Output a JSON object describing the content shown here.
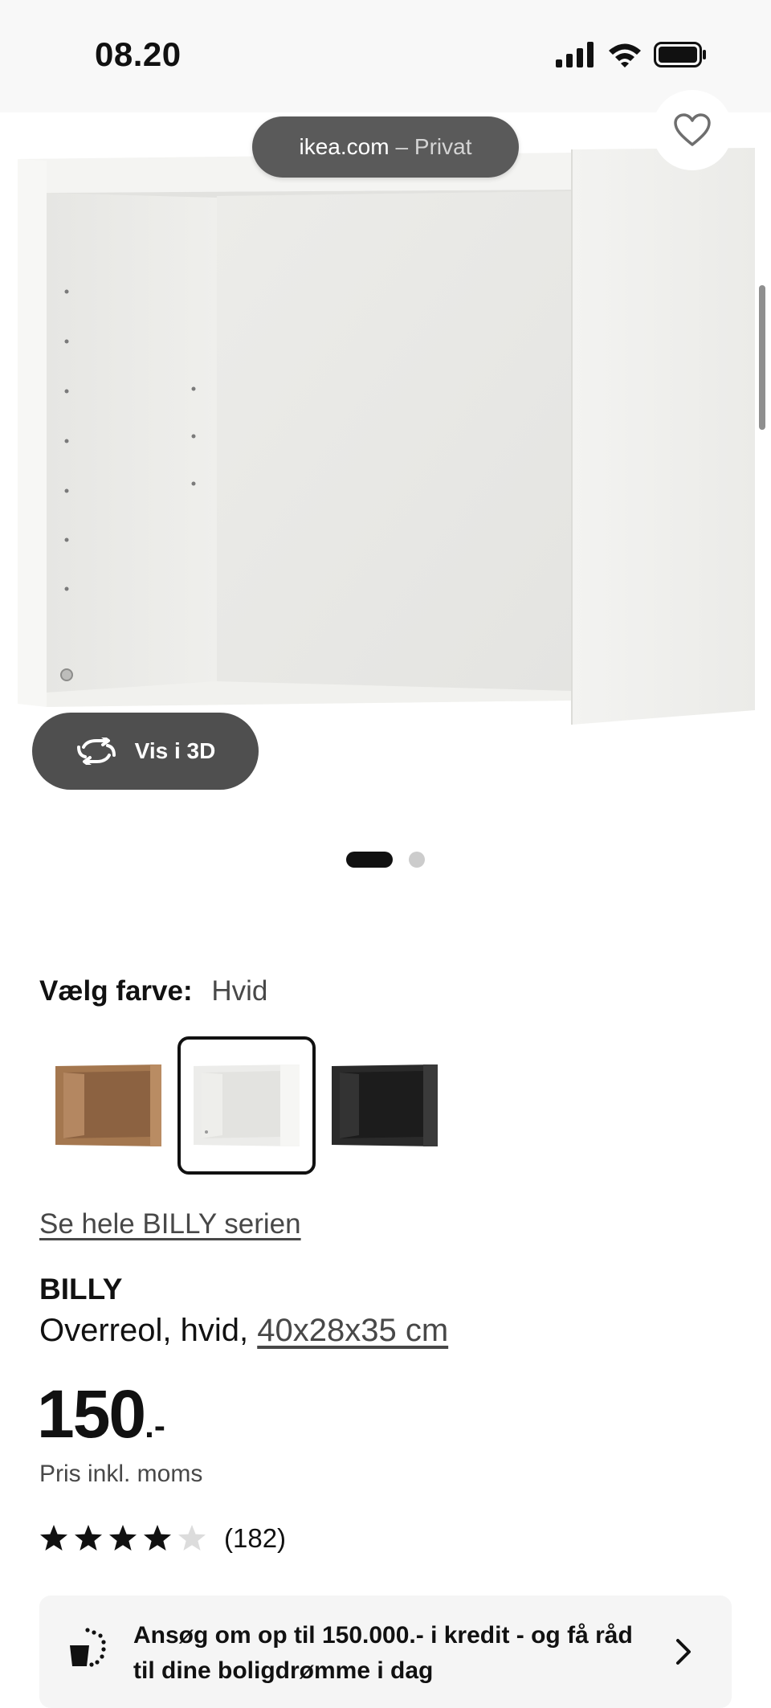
{
  "status_bar": {
    "time": "08.20"
  },
  "browser": {
    "domain": "ikea.com",
    "mode": "– Privat"
  },
  "gallery": {
    "view_3d_label": "Vis i 3D",
    "image_count": 2,
    "active_index": 0
  },
  "color": {
    "label": "Vælg farve:",
    "selected_value": "Hvid",
    "swatches": [
      {
        "name": "Valnøddemønster",
        "color": "#a97c55"
      },
      {
        "name": "Hvid",
        "color": "#f2f2f0",
        "selected": true
      },
      {
        "name": "Sort",
        "color": "#2b2b2b"
      }
    ]
  },
  "series_link": "Se hele BILLY serien",
  "product": {
    "name": "BILLY",
    "description": "Overreol, hvid,",
    "dimensions": "40x28x35 cm",
    "price": "150",
    "price_suffix": ".-",
    "price_note": "Pris inkl. moms",
    "rating_value": 4.5,
    "rating_max": 5,
    "rating_count": "(182)"
  },
  "credit_banner": {
    "text": "Ansøg om op til 150.000.- i kredit - og få råd til dine boligdrømme i dag"
  },
  "colors": {
    "text": "#111111",
    "muted": "#484848",
    "pill": "#5a5a5a"
  }
}
